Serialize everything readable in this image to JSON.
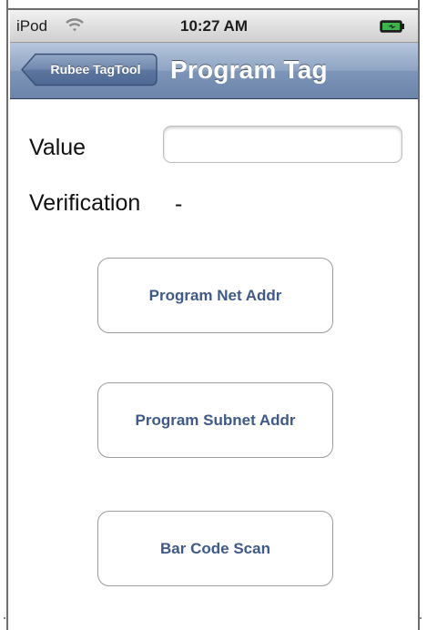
{
  "status_bar": {
    "carrier": "iPod",
    "time": "10:27 AM",
    "wifi_icon": "wifi-icon",
    "battery_icon": "battery-charging-icon"
  },
  "nav_bar": {
    "back_label": "Rubee TagTool",
    "title": "Program Tag",
    "colors": {
      "bar_top": "#b6c6dd",
      "bar_bottom": "#6c84aa"
    }
  },
  "form": {
    "value_label": "Value",
    "value_input": "",
    "verification_label": "Verification",
    "verification_value": "-"
  },
  "buttons": {
    "program_net_addr": "Program Net Addr",
    "program_subnet_addr": "Program Subnet Addr",
    "bar_code_scan": "Bar Code Scan",
    "text_color": "#3f5a8a"
  }
}
